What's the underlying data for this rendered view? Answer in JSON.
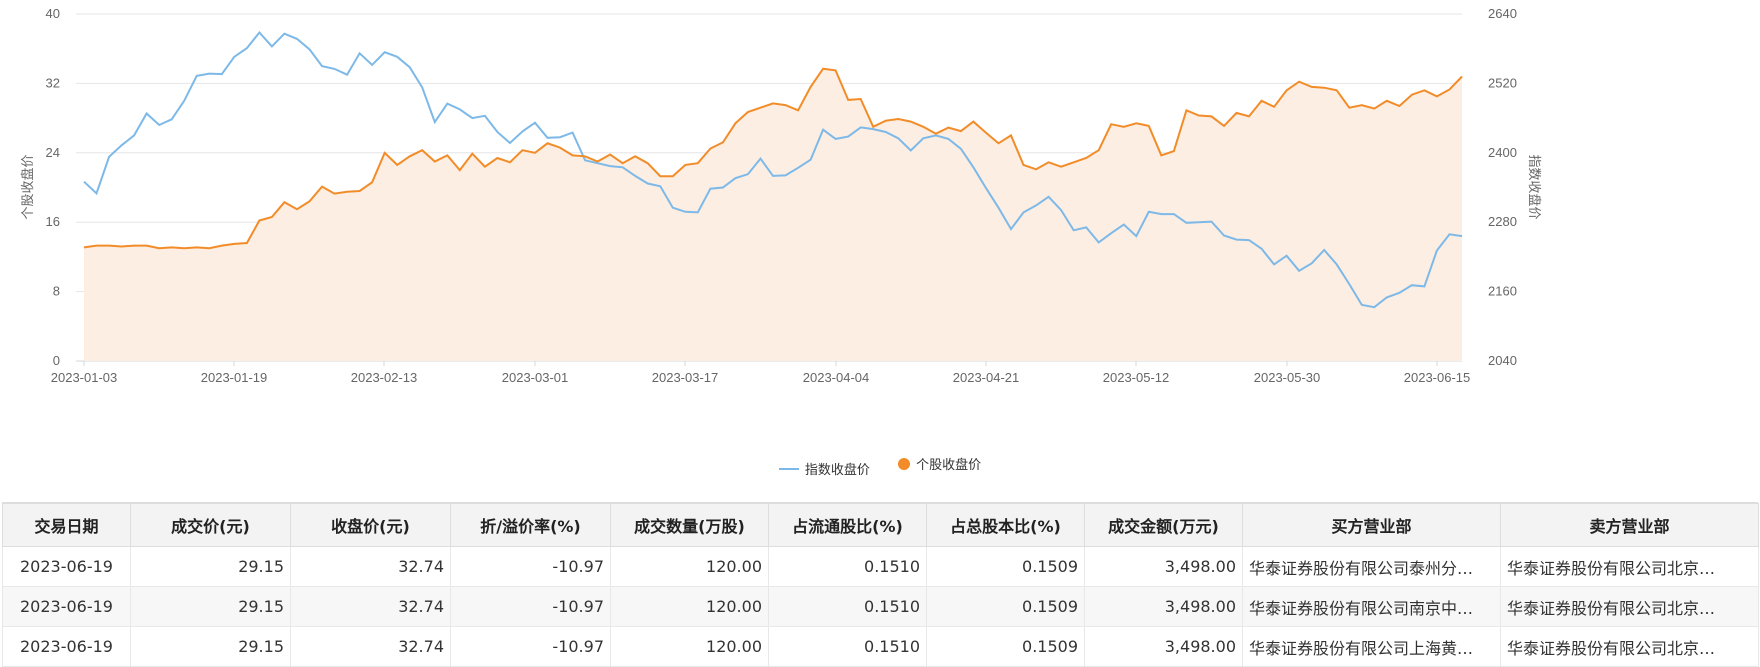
{
  "chart_data": {
    "type": "line",
    "x_tick_labels": [
      "2023-01-03",
      "2023-01-19",
      "2023-02-13",
      "2023-03-01",
      "2023-03-17",
      "2023-04-04",
      "2023-04-21",
      "2023-05-12",
      "2023-05-30",
      "2023-06-15"
    ],
    "y_left": {
      "label": "个股收盘价",
      "ticks": [
        "0",
        "8",
        "16",
        "24",
        "32",
        "40"
      ],
      "range": [
        0,
        40
      ]
    },
    "y_right": {
      "label": "指数收盘价",
      "ticks": [
        "2040",
        "2160",
        "2280",
        "2400",
        "2520",
        "2640"
      ],
      "range": [
        2040,
        2640
      ]
    },
    "legend_position": "bottom-center",
    "series": [
      {
        "name": "指数收盘价",
        "axis": "right",
        "color": "#7db9e8",
        "values": [
          2350,
          2330,
          2393,
          2413,
          2430,
          2468,
          2448,
          2458,
          2490,
          2533,
          2537,
          2536,
          2566,
          2581,
          2608,
          2584,
          2606,
          2597,
          2579,
          2550,
          2545,
          2535,
          2572,
          2552,
          2574,
          2566,
          2548,
          2513,
          2453,
          2485,
          2475,
          2460,
          2464,
          2436,
          2417,
          2437,
          2452,
          2426,
          2427,
          2435,
          2387,
          2382,
          2377,
          2375,
          2360,
          2347,
          2342,
          2305,
          2298,
          2297,
          2338,
          2340,
          2356,
          2363,
          2390,
          2360,
          2361,
          2374,
          2388,
          2440,
          2424,
          2428,
          2444,
          2441,
          2436,
          2425,
          2404,
          2425,
          2430,
          2424,
          2407,
          2375,
          2339,
          2305,
          2268,
          2297,
          2309,
          2324,
          2301,
          2266,
          2271,
          2245,
          2261,
          2276,
          2256,
          2298,
          2294,
          2294,
          2279,
          2280,
          2281,
          2257,
          2250,
          2249,
          2234,
          2207,
          2222,
          2196,
          2209,
          2232,
          2207,
          2173,
          2137,
          2133,
          2150,
          2158,
          2171,
          2169,
          2231,
          2259,
          2256
        ]
      },
      {
        "name": "个股收盘价",
        "axis": "left",
        "color": "#f28c28",
        "fill": "#fdeee3",
        "values": [
          13.1,
          13.3,
          13.3,
          13.2,
          13.3,
          13.3,
          13.0,
          13.1,
          13.0,
          13.1,
          13.0,
          13.3,
          13.5,
          13.6,
          16.2,
          16.6,
          18.3,
          17.5,
          18.4,
          20.1,
          19.3,
          19.5,
          19.6,
          20.6,
          24.0,
          22.6,
          23.6,
          24.3,
          23.0,
          23.7,
          22.0,
          23.9,
          22.4,
          23.4,
          22.9,
          24.3,
          24.0,
          25.1,
          24.6,
          23.7,
          23.6,
          23.0,
          23.8,
          22.8,
          23.6,
          22.8,
          21.3,
          21.3,
          22.6,
          22.8,
          24.5,
          25.2,
          27.4,
          28.7,
          29.2,
          29.7,
          29.5,
          28.9,
          31.6,
          33.7,
          33.5,
          30.1,
          30.2,
          27.0,
          27.7,
          27.9,
          27.6,
          27.0,
          26.2,
          26.9,
          26.5,
          27.6,
          26.3,
          25.1,
          26.0,
          22.6,
          22.1,
          22.9,
          22.4,
          22.9,
          23.4,
          24.3,
          27.3,
          27.0,
          27.4,
          27.1,
          23.7,
          24.2,
          28.9,
          28.3,
          28.2,
          27.1,
          28.6,
          28.2,
          30.0,
          29.3,
          31.2,
          32.2,
          31.6,
          31.5,
          31.2,
          29.2,
          29.5,
          29.1,
          30.0,
          29.4,
          30.7,
          31.2,
          30.5,
          31.3,
          32.8
        ]
      }
    ]
  },
  "table": {
    "headers": [
      "交易日期",
      "成交价(元)",
      "收盘价(元)",
      "折/溢价率(%)",
      "成交数量(万股)",
      "占流通股比(%)",
      "占总股本比(%)",
      "成交金额(万元)",
      "买方营业部",
      "卖方营业部"
    ],
    "rows": [
      [
        "2023-06-19",
        "29.15",
        "32.74",
        "-10.97",
        "120.00",
        "0.1510",
        "0.1509",
        "3,498.00",
        "华泰证券股份有限公司泰州分…",
        "华泰证券股份有限公司北京…"
      ],
      [
        "2023-06-19",
        "29.15",
        "32.74",
        "-10.97",
        "120.00",
        "0.1510",
        "0.1509",
        "3,498.00",
        "华泰证券股份有限公司南京中…",
        "华泰证券股份有限公司北京…"
      ],
      [
        "2023-06-19",
        "29.15",
        "32.74",
        "-10.97",
        "120.00",
        "0.1510",
        "0.1509",
        "3,498.00",
        "华泰证券股份有限公司上海黄…",
        "华泰证券股份有限公司北京…"
      ]
    ]
  }
}
